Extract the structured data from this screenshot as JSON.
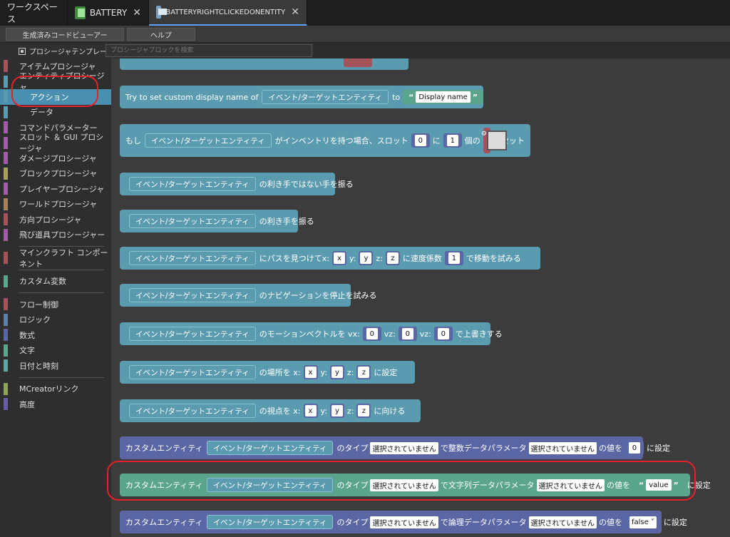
{
  "tabs": {
    "workspace": "ワークスペース",
    "battery": "BATTERY",
    "procedure": "BATTERYRIGHTCLICKEDONENTITY",
    "close": "✕"
  },
  "toolbar": {
    "code_viewer": "生成済みコードビューアー",
    "help": "ヘルプ"
  },
  "search": {
    "template_label": "プロシージャテンプレート",
    "placeholder": "プロシージャブロックを検索"
  },
  "sidebar": {
    "items": [
      {
        "label": "アイテムプロシージャ",
        "color": "#a5525b"
      },
      {
        "label": "エンティティプロシージャ",
        "color": "#5a9bb0"
      },
      {
        "label": "アクション",
        "color": "#5a9bb0"
      },
      {
        "label": "データ",
        "color": "#5a9bb0"
      },
      {
        "label": "コマンドパラメーター",
        "color": "#a05ba5"
      },
      {
        "label": "スロット ＆ GUI プロシージャ",
        "color": "#a05ba5"
      },
      {
        "label": "ダメージプロシージャ",
        "color": "#a05ba5"
      },
      {
        "label": "ブロックプロシージャ",
        "color": "#a5a05b"
      },
      {
        "label": "プレイヤープロシージャ",
        "color": "#a05ba5"
      },
      {
        "label": "ワールドプロシージャ",
        "color": "#a5825b"
      },
      {
        "label": "方向プロシージャ",
        "color": "#a5525b"
      },
      {
        "label": "飛び道具プロシージャー",
        "color": "#a05ba5"
      },
      {
        "label": "マインクラフト コンポーネント",
        "color": "#a5525b"
      },
      {
        "label": "カスタム変数",
        "color": "#5ba58c"
      },
      {
        "label": "フロー制御",
        "color": "#a5525b"
      },
      {
        "label": "ロジック",
        "color": "#5b80a5"
      },
      {
        "label": "数式",
        "color": "#5b67a5"
      },
      {
        "label": "文字",
        "color": "#5ba58c"
      },
      {
        "label": "日付と時刻",
        "color": "#5ba5a5"
      },
      {
        "label": "MCreatorリンク",
        "color": "#8ca55b"
      },
      {
        "label": "高度",
        "color": "#6b5ba5"
      }
    ]
  },
  "blocks": {
    "entity": "イベント/ターゲットエンティティ",
    "custom_entity": "カスタムエンティティ",
    "b1": {
      "text": "Try to set custom display name of",
      "to": "to",
      "str": "Display name"
    },
    "b2": {
      "if": "もし",
      "mid": "がインベントリを持つ場合、スロット",
      "slot": "0",
      "ni": "に",
      "count": "1",
      "ko": "個の",
      "set": "をセット"
    },
    "b3": {
      "text": "の利き手ではない手を振る"
    },
    "b4": {
      "text": "の利き手を振る"
    },
    "b5": {
      "mid": "にパスを見つけてx:",
      "x": "x",
      "ylab": "y:",
      "y": "y",
      "zlab": "z:",
      "z": "z",
      "speed": "に速度係数",
      "speedv": "1",
      "end": "で移動を試みる"
    },
    "b6": {
      "text": "のナビゲーションを停止を試みる"
    },
    "b7": {
      "mid": "のモーションベクトルを vx:",
      "vx": "0",
      "vylab": "vz:",
      "vy": "0",
      "vzlab": "vz:",
      "vz": "0",
      "end": "で上書きする"
    },
    "b8": {
      "mid": "の場所を x:",
      "x": "x",
      "ylab": "y:",
      "y": "y",
      "zlab": "z:",
      "z": "z",
      "end": "に設定"
    },
    "b9": {
      "mid": "の視点を x:",
      "x": "x",
      "ylab": "y:",
      "y": "y",
      "zlab": "z:",
      "z": "z",
      "end": "に向ける"
    },
    "b10": {
      "type_lbl": "のタイプ",
      "sel1": "選択されていません",
      "mid": "で整数データパラメータ",
      "sel2": "選択されていません",
      "val_lbl": "の値を",
      "val": "0",
      "end": "に設定"
    },
    "b11": {
      "type_lbl": "のタイプ",
      "sel1": "選択されていません",
      "mid": "で文字列データパラメータ",
      "sel2": "選択されていません",
      "val_lbl": "の値を",
      "val": "value",
      "end": "に設定"
    },
    "b12": {
      "type_lbl": "のタイプ",
      "sel1": "選択されていません",
      "mid": "で論理データパラメータ",
      "sel2": "選択されていません",
      "val_lbl": "の値を",
      "val": "false ˅",
      "end": "に設定"
    }
  },
  "colors": {
    "entity_block": "#5a9bb0",
    "text_block": "#5ba58c",
    "math_block": "#5b67a5",
    "highlight": "#e8202a"
  }
}
